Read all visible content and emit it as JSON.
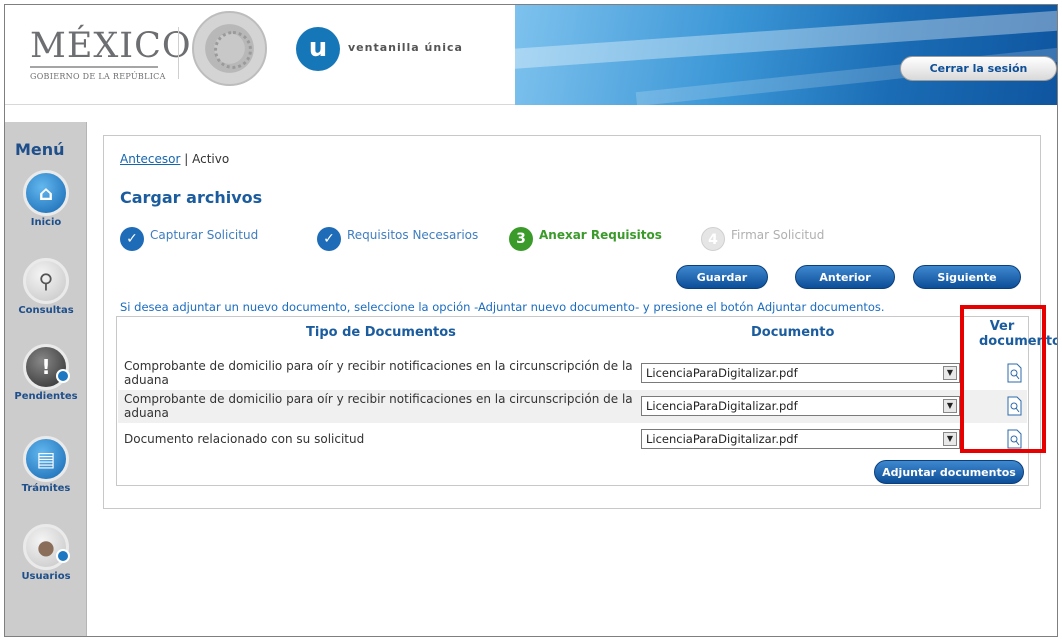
{
  "header": {
    "brand_word": "MÉXICO",
    "brand_sub": "GOBIERNO DE LA REPÚBLICA",
    "vu_letter": "u",
    "vu_text": "ventanilla única",
    "logout_label": "Cerrar la sesión"
  },
  "sidebar": {
    "title": "Menú",
    "items": [
      {
        "label": "Inicio",
        "icon": "home-icon",
        "glyph": "⌂"
      },
      {
        "label": "Consultas",
        "icon": "magnifier-icon",
        "glyph": "⚲"
      },
      {
        "label": "Pendientes",
        "icon": "exclamation-icon",
        "glyph": "!"
      },
      {
        "label": "Trámites",
        "icon": "document-icon",
        "glyph": "▤"
      },
      {
        "label": "Usuarios",
        "icon": "users-icon",
        "glyph": "●"
      }
    ]
  },
  "breadcrumb": {
    "link": "Antecesor",
    "separator": "|",
    "current": "Activo"
  },
  "page_title": "Cargar archivos",
  "steps": [
    {
      "num": "✓",
      "label": "Capturar Solicitud",
      "state": "done"
    },
    {
      "num": "✓",
      "label": "Requisitos Necesarios",
      "state": "done"
    },
    {
      "num": "3",
      "label": "Anexar Requisitos",
      "state": "active"
    },
    {
      "num": "4",
      "label": "Firmar Solicitud",
      "state": "todo"
    }
  ],
  "actions": {
    "save": "Guardar",
    "back": "Anterior",
    "next": "Siguiente",
    "attach": "Adjuntar documentos"
  },
  "notice": "Si desea adjuntar un nuevo documento, seleccione la opción -Adjuntar nuevo documento- y presione el botón Adjuntar documentos.",
  "table": {
    "headers": {
      "type": "Tipo de Documentos",
      "doc": "Documento",
      "view_1": "Ver",
      "view_2": "documento"
    },
    "rows": [
      {
        "desc": "Comprobante de domicilio para oír y recibir notificaciones en la circunscripción de la aduana",
        "file": "LicenciaParaDigitalizar.pdf"
      },
      {
        "desc": "Comprobante de domicilio para oír y recibir notificaciones en la circunscripción de la aduana",
        "file": "LicenciaParaDigitalizar.pdf"
      },
      {
        "desc": "Documento relacionado con su solicitud",
        "file": "LicenciaParaDigitalizar.pdf"
      }
    ]
  },
  "colors": {
    "accent": "#1a5c9e",
    "active_step": "#3a9a2a",
    "highlight": "#e60000"
  }
}
